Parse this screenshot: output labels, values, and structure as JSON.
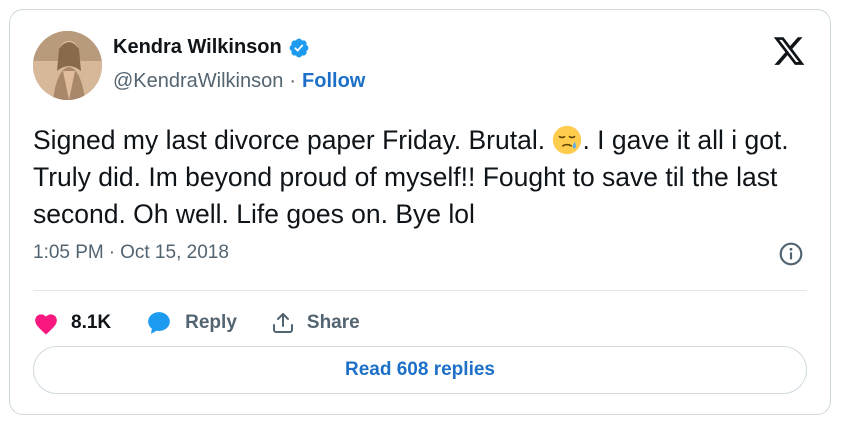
{
  "author": {
    "name": "Kendra Wilkinson",
    "handle": "@KendraWilkinson",
    "separator": "·",
    "follow_label": "Follow",
    "verified_icon": "verified-badge-icon"
  },
  "tweet": {
    "text_before_emoji": "Signed my last divorce paper Friday.  Brutal. ",
    "emoji": "sad-tear-emoji",
    "text_after_emoji": ". I gave it all i got. Truly did. Im beyond proud of myself!! Fought to save til the last second. Oh well. Life goes on. Bye lol",
    "time": "1:05 PM",
    "separator": "·",
    "date": "Oct 15, 2018"
  },
  "actions": {
    "likes_count": "8.1K",
    "reply_label": "Reply",
    "share_label": "Share"
  },
  "read_replies_label": "Read 608 replies",
  "colors": {
    "accent_blue": "#1d70c8",
    "heart_pink": "#f91880",
    "verified_blue": "#1d9bf0",
    "muted_text": "#536471",
    "border": "#cfd9de"
  }
}
